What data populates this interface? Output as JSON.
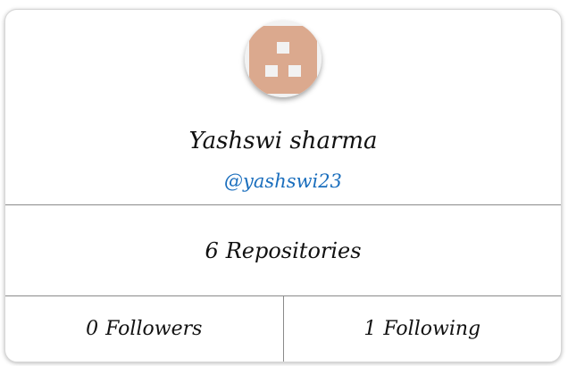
{
  "profile": {
    "name": "Yashswi sharma",
    "handle": "@yashswi23"
  },
  "stats": {
    "repositories_count": "6",
    "repositories_label": "Repositories",
    "followers_count": "0",
    "followers_label": "Followers",
    "following_count": "1",
    "following_label": "Following"
  },
  "colors": {
    "avatar_fill": "#dba98e",
    "avatar_background": "#f2f2f2",
    "handle_link": "#1a6ebd",
    "divider": "#8a8a8a"
  }
}
